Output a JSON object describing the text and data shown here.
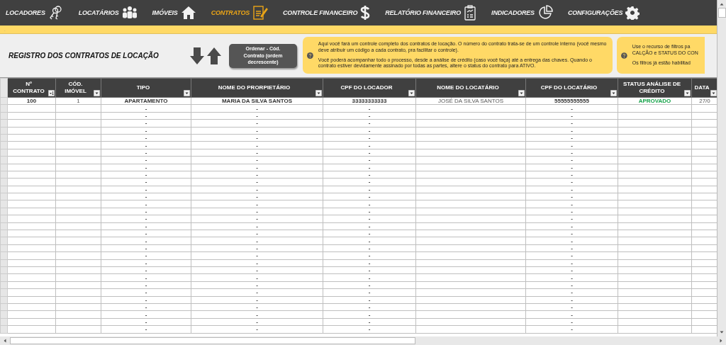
{
  "nav": [
    {
      "label": "LOCADORES",
      "selected": false
    },
    {
      "label": "LOCATÁRIOS",
      "selected": false
    },
    {
      "label": "IMÓVEIS",
      "selected": false
    },
    {
      "label": "CONTRATOS",
      "selected": true
    },
    {
      "label": "CONTROLE FINANCEIRO",
      "selected": false
    },
    {
      "label": "RELATÓRIO FINANCEIRO",
      "selected": false
    },
    {
      "label": "INDICADORES",
      "selected": false
    },
    {
      "label": "CONFIGURAÇÕES",
      "selected": false
    }
  ],
  "strip_mark": ".",
  "title": "REGISTRO DOS CONTRATOS DE LOCAÇÃO",
  "sort_button": "Ordenar - Cód. Contrato (ordem decrescente)",
  "notes": [
    {
      "paragraphs": [
        "Aqui você fará um controle completo dos contratos de locação. O número do contrato trata-se de um controle interno (você mesmo deve atribuir um código a cada contrato, pra facilitar o controle).",
        "Você poderá acompanhar todo o processo, desde a análise de crédito (caso você faça) até a entrega das chaves. Quando o contrato estiver devidamente assinado por todas as partes, altere o status do contrato para ATIVO."
      ]
    },
    {
      "paragraphs": [
        "Use o recurso de filtros pa CALÇÃO e STATUS DO CON",
        "Os filtros já estão habilitad"
      ]
    }
  ],
  "table": {
    "columns": [
      {
        "label": "Nº CONTRATO",
        "sorted": true
      },
      {
        "label": "CÓD. IMÓVEL",
        "sorted": false
      },
      {
        "label": "TIPO",
        "sorted": false
      },
      {
        "label": "NOME DO PRORPIETÁRIO",
        "sorted": false
      },
      {
        "label": "CPF DO LOCADOR",
        "sorted": false
      },
      {
        "label": "NOME DO LOCATÁRIO",
        "sorted": false
      },
      {
        "label": "CPF DO LOCATÁRIO",
        "sorted": false
      },
      {
        "label": "STATUS ANÁLISE DE CRÉDITO",
        "sorted": false
      },
      {
        "label": "DATA",
        "sorted": false
      }
    ],
    "rows": [
      [
        "100",
        "1",
        "APARTAMENTO",
        "MARIA DA SILVA SANTOS",
        "33333333333",
        "JOSÉ DA SILVA SANTOS",
        "55555555555",
        "APROVADO",
        "27/0"
      ],
      [
        null,
        null,
        "-",
        "-",
        "-",
        null,
        "-",
        null,
        null
      ],
      [
        null,
        null,
        "-",
        "-",
        "-",
        null,
        "-",
        null,
        null
      ],
      [
        null,
        null,
        "-",
        "-",
        "-",
        null,
        "-",
        null,
        null
      ],
      [
        null,
        null,
        "-",
        "-",
        "-",
        null,
        "-",
        null,
        null
      ],
      [
        null,
        null,
        "-",
        "-",
        "-",
        null,
        "-",
        null,
        null
      ],
      [
        null,
        null,
        "-",
        "-",
        "-",
        null,
        "-",
        null,
        null
      ],
      [
        null,
        null,
        "-",
        "-",
        "-",
        null,
        "-",
        null,
        null
      ],
      [
        null,
        null,
        "-",
        "-",
        "-",
        null,
        "-",
        null,
        null
      ],
      [
        null,
        null,
        "-",
        "-",
        "-",
        null,
        "-",
        null,
        null
      ],
      [
        null,
        null,
        "-",
        "-",
        "-",
        null,
        "-",
        null,
        null
      ],
      [
        null,
        null,
        "-",
        "-",
        "-",
        null,
        "-",
        null,
        null
      ],
      [
        null,
        null,
        "-",
        "-",
        "-",
        null,
        "-",
        null,
        null
      ],
      [
        null,
        null,
        "-",
        "-",
        "-",
        null,
        "-",
        null,
        null
      ],
      [
        null,
        null,
        "-",
        "-",
        "-",
        null,
        "-",
        null,
        null
      ],
      [
        null,
        null,
        "-",
        "-",
        "-",
        null,
        "-",
        null,
        null
      ],
      [
        null,
        null,
        "-",
        "-",
        "-",
        null,
        "-",
        null,
        null
      ],
      [
        null,
        null,
        "-",
        "-",
        "-",
        null,
        "-",
        null,
        null
      ],
      [
        null,
        null,
        "-",
        "-",
        "-",
        null,
        "-",
        null,
        null
      ],
      [
        null,
        null,
        "-",
        "-",
        "-",
        null,
        "-",
        null,
        null
      ],
      [
        null,
        null,
        "-",
        "-",
        "-",
        null,
        "-",
        null,
        null
      ],
      [
        null,
        null,
        "-",
        "-",
        "-",
        null,
        "-",
        null,
        null
      ],
      [
        null,
        null,
        "-",
        "-",
        "-",
        null,
        "-",
        null,
        null
      ],
      [
        null,
        null,
        "-",
        "-",
        "-",
        null,
        "-",
        null,
        null
      ],
      [
        null,
        null,
        "-",
        "-",
        "-",
        null,
        "-",
        null,
        null
      ],
      [
        null,
        null,
        "-",
        "-",
        "-",
        null,
        "-",
        null,
        null
      ],
      [
        null,
        null,
        "-",
        "-",
        "-",
        null,
        "-",
        null,
        null
      ],
      [
        null,
        null,
        "-",
        "-",
        "-",
        null,
        "-",
        null,
        null
      ],
      [
        null,
        null,
        "-",
        "-",
        "-",
        null,
        "-",
        null,
        null
      ],
      [
        null,
        null,
        "-",
        "-",
        "-",
        null,
        "-",
        null,
        null
      ],
      [
        null,
        null,
        "-",
        "-",
        "-",
        null,
        "-",
        null,
        null
      ],
      [
        null,
        null,
        "-",
        "-",
        "-",
        null,
        "-",
        null,
        null
      ]
    ]
  }
}
